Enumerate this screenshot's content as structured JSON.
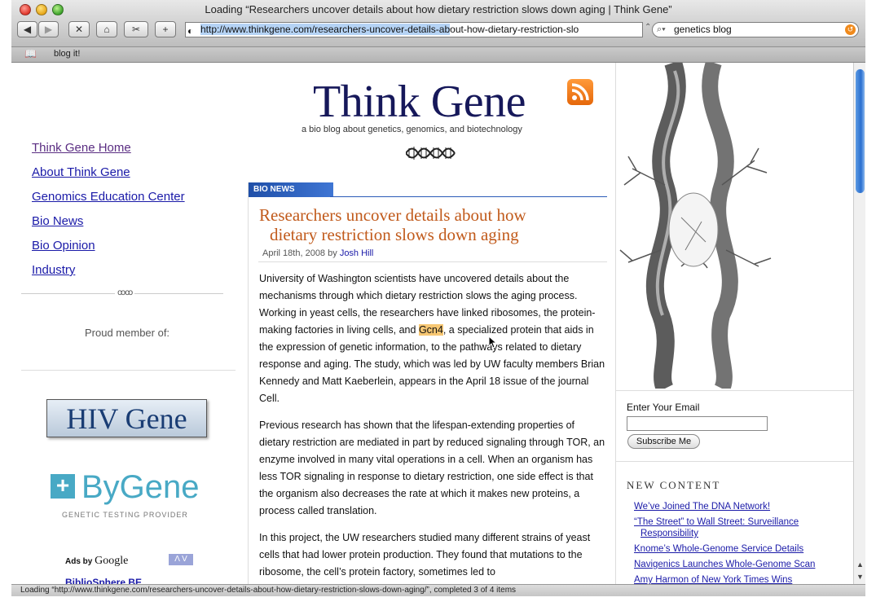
{
  "browser": {
    "window_title": "Loading “Researchers uncover details about how dietary restriction slows down aging | Think Gene”",
    "url_selected": "http://www.thinkgene.com/researchers-uncover-details-ab",
    "url_rest": "out-how-dietary-restriction-slo",
    "search_value": "genetics blog",
    "bookmark_label": "blog it!",
    "status_text": "Loading “http://www.thinkgene.com/researchers-uncover-details-about-how-dietary-restriction-slows-down-aging/”, completed 3 of 4 items",
    "buttons": {
      "back": "◀",
      "forward": "▶",
      "stop": "✕",
      "home": "⌂",
      "add": "+"
    }
  },
  "header": {
    "title": "Think Gene",
    "tagline": "a bio blog about genetics, genomics, and biotechnology"
  },
  "leftnav": {
    "items": [
      {
        "label": "Think Gene Home"
      },
      {
        "label": "About Think Gene"
      },
      {
        "label": "Genomics Education Center"
      },
      {
        "label": "Bio News"
      },
      {
        "label": "Bio Opinion"
      },
      {
        "label": "Industry"
      }
    ],
    "proud_member": "Proud member of:",
    "hiv_gene": "HIV Gene",
    "bygene": "ByGene",
    "bygene_sub": "GENETIC TESTING PROVIDER",
    "ads_by": "Ads by",
    "google": "Google",
    "ads_nav": "Λ V",
    "biblio": "BiblioSphere BE"
  },
  "post": {
    "category": "BIO NEWS",
    "title_line1": "Researchers uncover details about how",
    "title_line2": "dietary restriction slows down aging",
    "date": "April 18th, 2008",
    "by": "by",
    "author": "Josh Hill",
    "p1_a": "University of Washington scientists have uncovered details about the mechanisms through which dietary restriction slows the aging process. Working in yeast cells, the researchers have linked ribosomes, the protein-making factories in living cells, and ",
    "p1_highlight": "Gcn4",
    "p1_b": ", a specialized protein that aids in the expression of genetic information, to the pathways related to dietary response and aging. The study, which was led by UW faculty members Brian Kennedy and Matt Kaeberlein, appears in the April 18 issue of the journal Cell.",
    "p2": "Previous research has shown that the lifespan-extending properties of dietary restriction are mediated in part by reduced signaling through TOR, an enzyme involved in many vital operations in a cell. When an organism has less TOR signaling in response to dietary restriction, one side effect is that the organism also decreases the rate at which it makes new proteins, a process called translation.",
    "p3": "In this project, the UW researchers studied many different strains of yeast cells that had lower protein production. They found that mutations to the ribosome, the cell’s protein factory, sometimes led to"
  },
  "sidebar": {
    "email_label": "Enter Your Email",
    "subscribe": "Subscribe Me",
    "new_content_heading": "NEW CONTENT",
    "new_content": [
      {
        "line1": "We’ve Joined The DNA Network!",
        "line2": ""
      },
      {
        "line1": "“The Street” to Wall Street: Surveillance",
        "line2": "Responsibility"
      },
      {
        "line1": "Knome’s Whole-Genome Service Details",
        "line2": ""
      },
      {
        "line1": "Navigenics Launches Whole-Genome Scan",
        "line2": ""
      },
      {
        "line1": "Amy Harmon of New York Times Wins",
        "line2": ""
      }
    ]
  },
  "colors": {
    "title": "#16185a",
    "post_title": "#c15a1b",
    "link": "#1a1aa8",
    "badge": "#1f4fa8",
    "highlight": "#f7c773"
  }
}
